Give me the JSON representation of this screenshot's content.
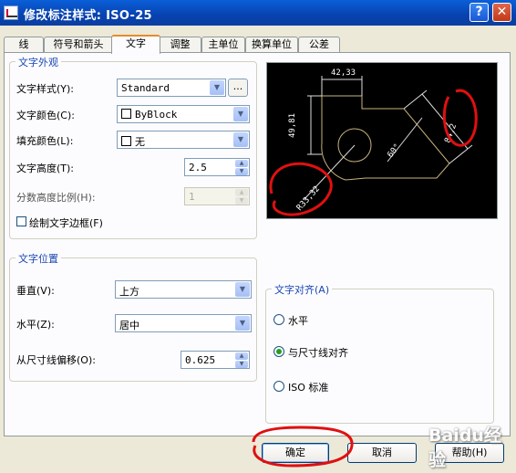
{
  "window": {
    "title": "修改标注样式: ISO-25",
    "help_label": "?",
    "close_label": "✕"
  },
  "tabs": [
    {
      "label": "线"
    },
    {
      "label": "符号和箭头"
    },
    {
      "label": "文字",
      "active": true
    },
    {
      "label": "调整"
    },
    {
      "label": "主单位"
    },
    {
      "label": "换算单位"
    },
    {
      "label": "公差"
    }
  ],
  "text_appearance": {
    "title": "文字外观",
    "style_label": "文字样式(Y):",
    "style_value": "Standard",
    "style_dots": "...",
    "color_label": "文字颜色(C):",
    "color_value": "ByBlock",
    "fill_label": "填充颜色(L):",
    "fill_value": "无",
    "height_label": "文字高度(T):",
    "height_value": "2.5",
    "fraction_label": "分数高度比例(H):",
    "fraction_value": "1",
    "frame_label": "绘制文字边框(F)",
    "frame_checked": false
  },
  "text_placement": {
    "title": "文字位置",
    "vertical_label": "垂直(V):",
    "vertical_value": "上方",
    "horizontal_label": "水平(Z):",
    "horizontal_value": "居中",
    "offset_label": "从尺寸线偏移(O):",
    "offset_value": "0.625"
  },
  "text_alignment": {
    "title": "文字对齐(A)",
    "options": [
      {
        "label": "水平",
        "checked": false
      },
      {
        "label": "与尺寸线对齐",
        "checked": true
      },
      {
        "label": "ISO 标准",
        "checked": false
      }
    ]
  },
  "preview": {
    "dim_top": "42,33",
    "dim_left": "49,81",
    "dim_right": "84,2",
    "dim_radius": "R33,32",
    "dim_angle": "60°"
  },
  "buttons": {
    "ok": "确定",
    "cancel": "取消",
    "help": "帮助(H)"
  },
  "watermark": "Baidu经验"
}
